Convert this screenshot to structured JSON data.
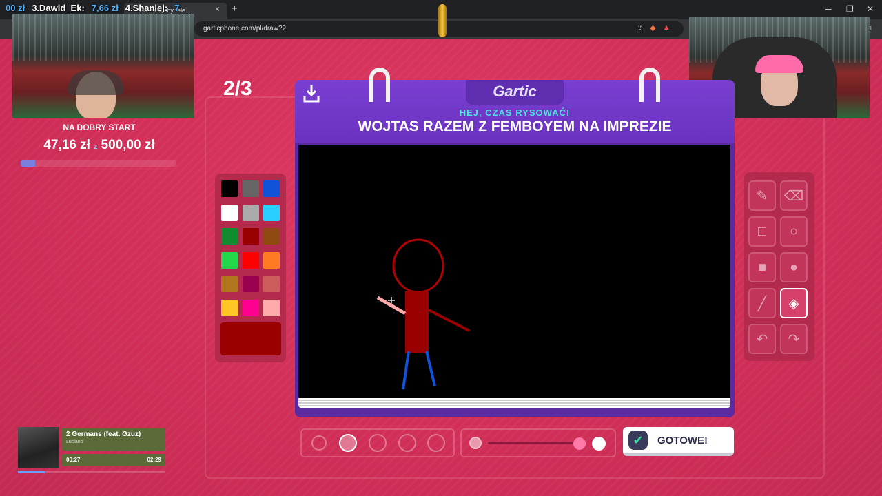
{
  "browser": {
    "tab_label": "Ga... Głuchy tele...",
    "url": "garticphone.com/pl/draw?2",
    "tab_add": "+",
    "tab_close": "×",
    "min": "─",
    "restore": "❐",
    "close": "✕"
  },
  "ticker": {
    "leader_prefix": "00 zł",
    "third": "3.Dawid_Ek:",
    "third_amount": "7,66 zł",
    "fourth": "4.Shanlej:",
    "fourth_amount": "7"
  },
  "goal": {
    "title": "NA DOBRY START",
    "current": "47,16 zł",
    "sep": "z",
    "target": "500,00 zł",
    "progress": 0.094
  },
  "round": "2/3",
  "header": {
    "logo": "Gartic",
    "subtitle": "HEJ, CZAS RYSOWAĆ!",
    "phrase": "WOJTAS RAZEM Z FEMBOYEM NA IMPREZIE"
  },
  "palette": {
    "colors": [
      "#000000",
      "#666666",
      "#1052d9",
      "#ffffff",
      "#aaaaaa",
      "#29d0ff",
      "#118a30",
      "#990000",
      "#8f4a12",
      "#22d84a",
      "#ff0000",
      "#ff7a22",
      "#b0761e",
      "#99004d",
      "#cc5c5c",
      "#ffc626",
      "#ff008f",
      "#ffaaaa"
    ],
    "current": "#9a0000"
  },
  "tools": [
    "pencil-icon",
    "eraser-icon",
    "rectangle-outline-icon",
    "ellipse-outline-icon",
    "rectangle-fill-icon",
    "ellipse-fill-icon",
    "line-icon",
    "bucket-fill-icon",
    "undo-icon",
    "redo-icon"
  ],
  "done_label": "GOTOWE!",
  "music": {
    "title": "2 Germans (feat. Gzuz)",
    "artist": "Luciano",
    "elapsed": "00:27",
    "total": "02:29",
    "progress": 0.18
  }
}
